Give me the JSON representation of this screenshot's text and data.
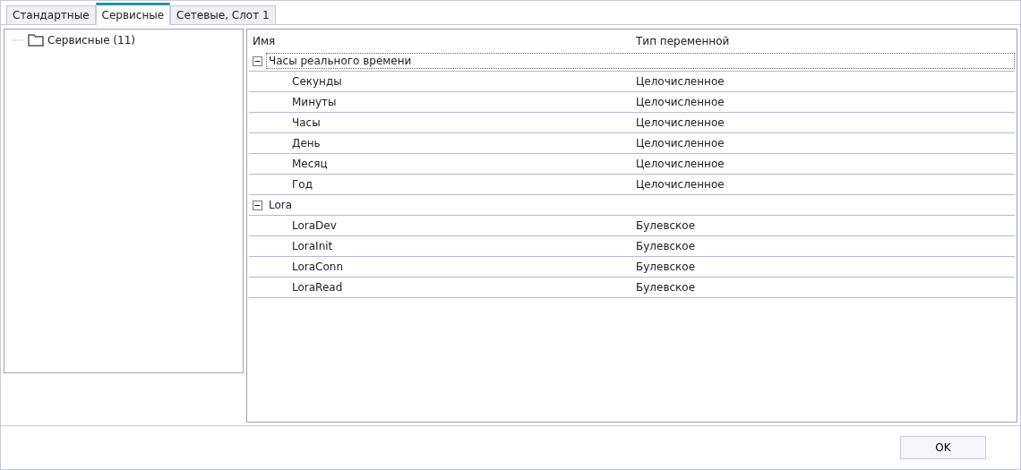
{
  "tabs": [
    {
      "label": "Стандартные",
      "selected": false
    },
    {
      "label": "Сервисные",
      "selected": true
    },
    {
      "label": "Сетевые, Слот 1",
      "selected": false
    }
  ],
  "tree": {
    "items": [
      {
        "label": "Сервисные (11)"
      }
    ]
  },
  "table": {
    "columns": [
      "Имя",
      "Тип переменной"
    ],
    "groups": [
      {
        "name": "Часы реального времени",
        "expanded": true,
        "selected": true,
        "rows": [
          {
            "name": "Секунды",
            "type": "Целочисленное"
          },
          {
            "name": "Минуты",
            "type": "Целочисленное"
          },
          {
            "name": "Часы",
            "type": "Целочисленное"
          },
          {
            "name": "День",
            "type": "Целочисленное"
          },
          {
            "name": "Месяц",
            "type": "Целочисленное"
          },
          {
            "name": "Год",
            "type": "Целочисленное"
          }
        ]
      },
      {
        "name": "Lora",
        "expanded": true,
        "selected": false,
        "rows": [
          {
            "name": "LoraDev",
            "type": "Булевское"
          },
          {
            "name": "LoraInit",
            "type": "Булевское"
          },
          {
            "name": "LoraConn",
            "type": "Булевское"
          },
          {
            "name": "LoraRead",
            "type": "Булевское"
          }
        ]
      }
    ]
  },
  "buttons": [
    "OK"
  ]
}
